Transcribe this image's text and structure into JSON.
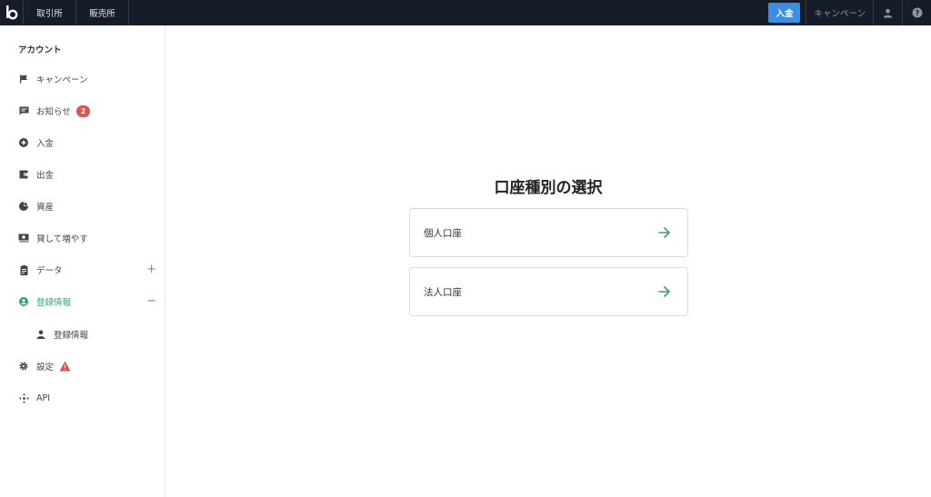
{
  "header": {
    "logo_icon": "b-logo-icon",
    "tabs": [
      "取引所",
      "販売所"
    ],
    "deposit_label": "入金",
    "campaign_label": "キャンペーン",
    "user_icon": "user-icon",
    "help_icon": "help-icon",
    "deposit_color": "#3a8ee6",
    "bg_color": "#171c2a"
  },
  "sidebar": {
    "title": "アカウント",
    "items": [
      {
        "label": "キャンペーン",
        "icon": "flag-icon"
      },
      {
        "label": "お知らせ",
        "icon": "message-icon",
        "badge": "2"
      },
      {
        "label": "入金",
        "icon": "plus-circle-icon"
      },
      {
        "label": "出金",
        "icon": "wallet-icon"
      },
      {
        "label": "資産",
        "icon": "pie-chart-icon"
      },
      {
        "label": "貸して増やす",
        "icon": "money-icon"
      },
      {
        "label": "データ",
        "icon": "clipboard-icon",
        "expander": "+"
      },
      {
        "label": "登録情報",
        "icon": "account-circle-icon",
        "expander": "−",
        "active": true
      },
      {
        "label": "登録情報",
        "icon": "person-icon",
        "sub": true
      },
      {
        "label": "設定",
        "icon": "gear-icon",
        "warning_icon": "warning-icon"
      },
      {
        "label": "API",
        "icon": "api-icon"
      }
    ],
    "active_color": "#3a9a8a"
  },
  "main": {
    "title": "口座種別の選択",
    "cards": [
      {
        "label": "個人口座",
        "icon": "arrow-right-icon"
      },
      {
        "label": "法人口座",
        "icon": "arrow-right-icon"
      }
    ]
  }
}
